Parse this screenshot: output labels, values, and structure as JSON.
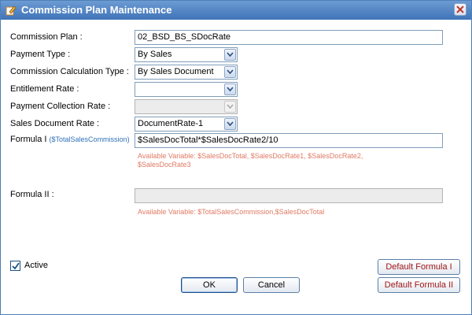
{
  "window": {
    "title": "Commission Plan Maintenance",
    "icon": "pencil-edit-icon",
    "close_icon": "close-icon"
  },
  "form": {
    "commission_plan": {
      "label": "Commission Plan :",
      "value": "02_BSD_BS_SDocRate"
    },
    "payment_type": {
      "label": "Payment Type :",
      "value": "By Sales"
    },
    "calc_type": {
      "label": "Commission Calculation Type :",
      "value": "By Sales Document"
    },
    "entitlement_rate": {
      "label": "Entitlement Rate :",
      "value": ""
    },
    "payment_collection_rate": {
      "label": "Payment Collection Rate :",
      "value": ""
    },
    "sales_doc_rate": {
      "label": "Sales Document Rate :",
      "value": "DocumentRate-1"
    },
    "formula1": {
      "label": "Formula I",
      "sublabel": "($TotalSalesCommission)",
      "value": "$SalesDocTotal*$SalesDocRate2/10",
      "hint_line1": "Available Variable:  $SalesDocTotal,  $SalesDocRate1,  $SalesDocRate2,",
      "hint_line2": "$SalesDocRate3"
    },
    "formula2": {
      "label": "Formula II :",
      "value": "",
      "hint": "Available Variable:  $TotalSalesCommission,$SalesDocTotal"
    }
  },
  "footer": {
    "active_label": "Active",
    "active_checked": true,
    "ok_label": "OK",
    "cancel_label": "Cancel",
    "default_formula1_label": "Default Formula I",
    "default_formula2_label": "Default Formula II"
  },
  "colors": {
    "titlebar": "#3f74b8",
    "hint_text": "#e07a63",
    "formula_button_text": "#a01818",
    "sublabel_text": "#2f72b7"
  }
}
